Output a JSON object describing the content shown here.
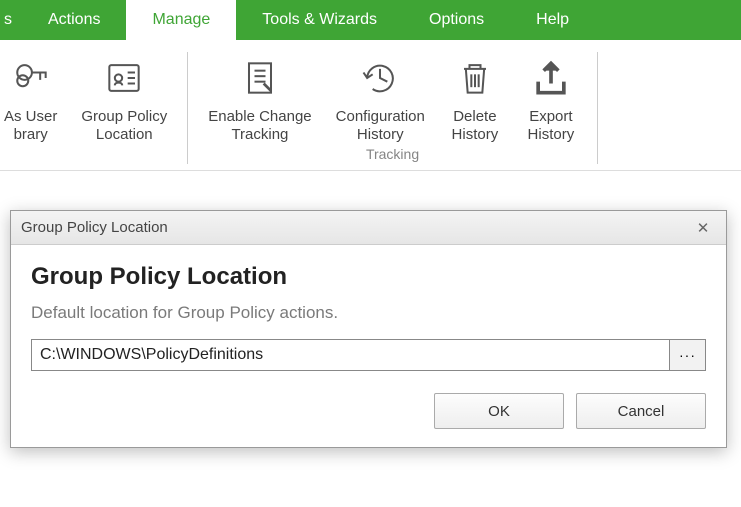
{
  "menubar": {
    "items": [
      {
        "label": "s"
      },
      {
        "label": "Actions"
      },
      {
        "label": "Manage",
        "active": true
      },
      {
        "label": "Tools & Wizards"
      },
      {
        "label": "Options"
      },
      {
        "label": "Help"
      }
    ]
  },
  "ribbon": {
    "buttons": [
      {
        "label": "As User\nbrary",
        "icon": "key-icon"
      },
      {
        "label": "Group Policy\nLocation",
        "icon": "card-icon"
      },
      {
        "label": "Enable Change\nTracking",
        "icon": "document-icon"
      },
      {
        "label": "Configuration\nHistory",
        "icon": "history-icon"
      },
      {
        "label": "Delete\nHistory",
        "icon": "trash-icon"
      },
      {
        "label": "Export\nHistory",
        "icon": "export-icon"
      }
    ],
    "group_label": "Tracking"
  },
  "dialog": {
    "title": "Group Policy Location",
    "heading": "Group Policy Location",
    "description": "Default location for Group Policy actions.",
    "path_value": "C:\\WINDOWS\\PolicyDefinitions",
    "browse_label": "···",
    "ok_label": "OK",
    "cancel_label": "Cancel"
  }
}
